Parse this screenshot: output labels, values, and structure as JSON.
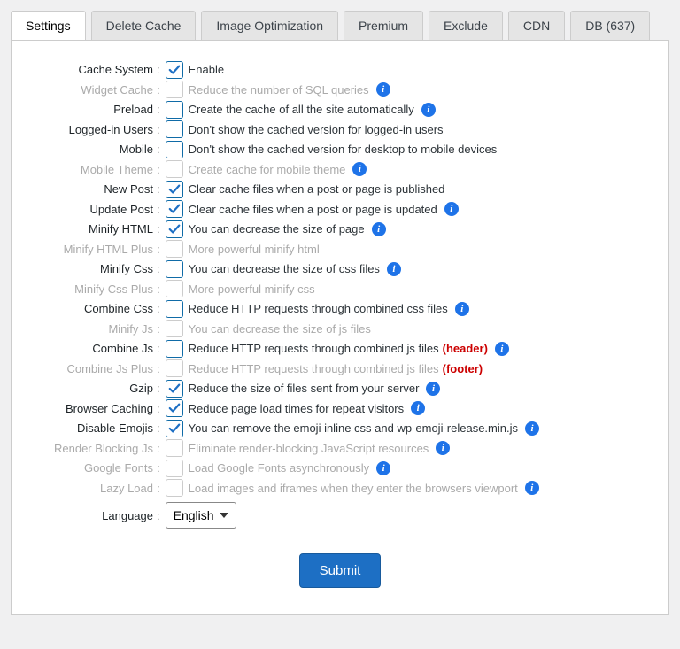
{
  "tabs": [
    {
      "id": "settings",
      "label": "Settings",
      "active": true
    },
    {
      "id": "delete-cache",
      "label": "Delete Cache",
      "active": false
    },
    {
      "id": "image-opt",
      "label": "Image Optimization",
      "active": false
    },
    {
      "id": "premium",
      "label": "Premium",
      "active": false
    },
    {
      "id": "exclude",
      "label": "Exclude",
      "active": false
    },
    {
      "id": "cdn",
      "label": "CDN",
      "active": false
    },
    {
      "id": "db",
      "label": "DB (637)",
      "active": false
    }
  ],
  "rows": [
    {
      "key": "cache_system",
      "label": "Cache System",
      "desc": "Enable",
      "checked": true,
      "disabled": false,
      "info": false
    },
    {
      "key": "widget_cache",
      "label": "Widget Cache",
      "desc": "Reduce the number of SQL queries",
      "checked": false,
      "disabled": true,
      "info": true
    },
    {
      "key": "preload",
      "label": "Preload",
      "desc": "Create the cache of all the site automatically",
      "checked": false,
      "disabled": false,
      "info": true
    },
    {
      "key": "logged_in_users",
      "label": "Logged-in Users",
      "desc": "Don't show the cached version for logged-in users",
      "checked": false,
      "disabled": false,
      "info": false
    },
    {
      "key": "mobile",
      "label": "Mobile",
      "desc": "Don't show the cached version for desktop to mobile devices",
      "checked": false,
      "disabled": false,
      "info": false
    },
    {
      "key": "mobile_theme",
      "label": "Mobile Theme",
      "desc": "Create cache for mobile theme",
      "checked": false,
      "disabled": true,
      "info": true
    },
    {
      "key": "new_post",
      "label": "New Post",
      "desc": "Clear cache files when a post or page is published",
      "checked": true,
      "disabled": false,
      "info": false
    },
    {
      "key": "update_post",
      "label": "Update Post",
      "desc": "Clear cache files when a post or page is updated",
      "checked": true,
      "disabled": false,
      "info": true
    },
    {
      "key": "minify_html",
      "label": "Minify HTML",
      "desc": "You can decrease the size of page",
      "checked": true,
      "disabled": false,
      "info": true
    },
    {
      "key": "minify_html_plus",
      "label": "Minify HTML Plus",
      "desc": "More powerful minify html",
      "checked": false,
      "disabled": true,
      "info": false
    },
    {
      "key": "minify_css",
      "label": "Minify Css",
      "desc": "You can decrease the size of css files",
      "checked": false,
      "disabled": false,
      "info": true
    },
    {
      "key": "minify_css_plus",
      "label": "Minify Css Plus",
      "desc": "More powerful minify css",
      "checked": false,
      "disabled": true,
      "info": false
    },
    {
      "key": "combine_css",
      "label": "Combine Css",
      "desc": "Reduce HTTP requests through combined css files",
      "checked": false,
      "disabled": false,
      "info": true
    },
    {
      "key": "minify_js",
      "label": "Minify Js",
      "desc": "You can decrease the size of js files",
      "checked": false,
      "disabled": true,
      "info": false
    },
    {
      "key": "combine_js",
      "label": "Combine Js",
      "desc": "Reduce HTTP requests through combined js files",
      "extra": "(header)",
      "checked": false,
      "disabled": false,
      "info": true
    },
    {
      "key": "combine_js_plus",
      "label": "Combine Js Plus",
      "desc": "Reduce HTTP requests through combined js files",
      "extra": "(footer)",
      "checked": false,
      "disabled": true,
      "info": false
    },
    {
      "key": "gzip",
      "label": "Gzip",
      "desc": "Reduce the size of files sent from your server",
      "checked": true,
      "disabled": false,
      "info": true
    },
    {
      "key": "browser_caching",
      "label": "Browser Caching",
      "desc": "Reduce page load times for repeat visitors",
      "checked": true,
      "disabled": false,
      "info": true
    },
    {
      "key": "disable_emojis",
      "label": "Disable Emojis",
      "desc": "You can remove the emoji inline css and wp-emoji-release.min.js",
      "checked": true,
      "disabled": false,
      "info": true
    },
    {
      "key": "render_blocking_js",
      "label": "Render Blocking Js",
      "desc": "Eliminate render-blocking JavaScript resources",
      "checked": false,
      "disabled": true,
      "info": true
    },
    {
      "key": "google_fonts",
      "label": "Google Fonts",
      "desc": "Load Google Fonts asynchronously",
      "checked": false,
      "disabled": true,
      "info": true
    },
    {
      "key": "lazy_load",
      "label": "Lazy Load",
      "desc": "Load images and iframes when they enter the browsers viewport",
      "checked": false,
      "disabled": true,
      "info": true
    }
  ],
  "language": {
    "label": "Language",
    "selected": "English",
    "options": [
      "English"
    ]
  },
  "submit": {
    "label": "Submit"
  },
  "colors": {
    "accent": "#1d6fc4",
    "info": "#1e73e8",
    "extra": "#c00"
  }
}
